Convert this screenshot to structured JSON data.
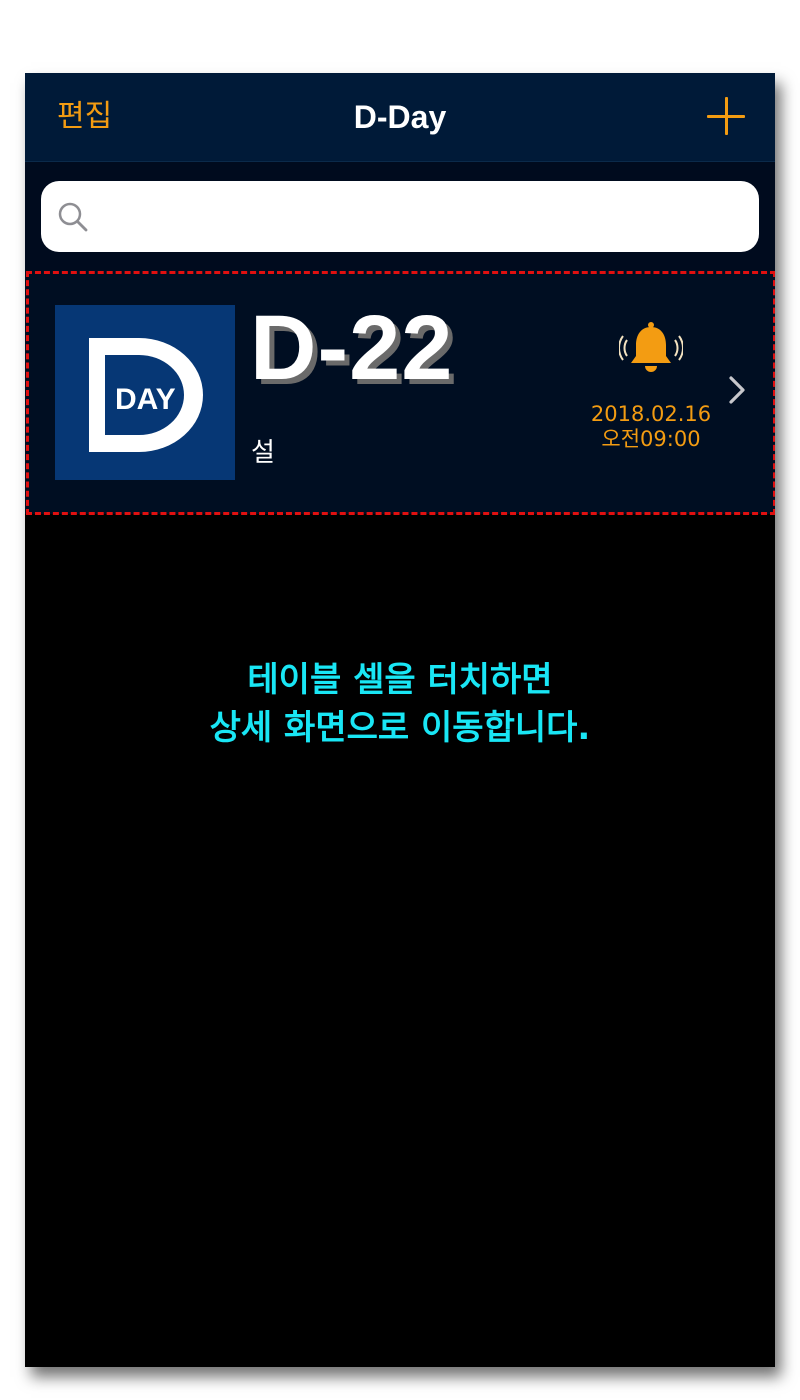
{
  "navbar": {
    "edit_label": "편집",
    "title": "D-Day",
    "add_icon": "plus-icon",
    "accent_color": "#f39c12",
    "background": "#001a38"
  },
  "search": {
    "placeholder": "",
    "value": "",
    "icon": "search-icon"
  },
  "list": {
    "items": [
      {
        "thumbnail_text": "DAY",
        "count": "D-22",
        "title": "설",
        "date": "2018.02.16",
        "time": "오전09:00",
        "alarm_icon": "bell-ringing-icon",
        "disclosure_icon": "chevron-right-icon"
      }
    ]
  },
  "hint": {
    "line1": "테이블 셀을 터치하면",
    "line2": "상세 화면으로 이동합니다.",
    "color": "#19e6f5",
    "outline_color": "#e01010"
  }
}
